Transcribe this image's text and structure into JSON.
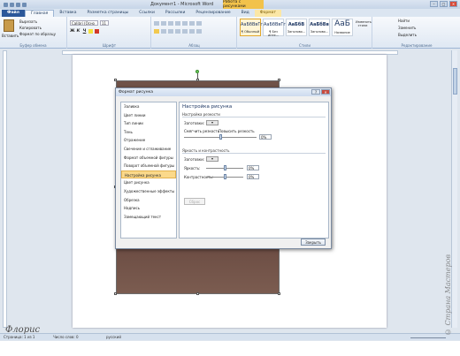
{
  "window": {
    "title": "Документ1 - Microsoft Word",
    "context_title": "Работа с рисунками"
  },
  "tabs": [
    "Файл",
    "Главная",
    "Вставка",
    "Разметка страницы",
    "Ссылки",
    "Рассылки",
    "Рецензирование",
    "Вид",
    "Формат"
  ],
  "ribbon": {
    "clipboard": {
      "paste": "Вставить",
      "cut": "Вырезать",
      "copy": "Копировать",
      "format_painter": "Формат по образцу",
      "label": "Буфер обмена"
    },
    "font": {
      "name": "Calibri (Осно",
      "size": "11",
      "label": "Шрифт",
      "bold": "Ж",
      "italic": "К",
      "underline": "Ч"
    },
    "paragraph": {
      "label": "Абзац"
    },
    "styles": {
      "label": "Стили",
      "items": [
        {
          "sample": "АаБбВвГг,",
          "name": "¶ Обычный"
        },
        {
          "sample": "АаБбВвГг,",
          "name": "¶ Без инте..."
        },
        {
          "sample": "АаБбВ",
          "name": "Заголово..."
        },
        {
          "sample": "АаБбВв",
          "name": "Заголово..."
        },
        {
          "sample": "АаБ",
          "name": "Название"
        }
      ],
      "change_styles": "Изменить стили"
    },
    "editing": {
      "find": "Найти",
      "replace": "Заменить",
      "select": "Выделить",
      "label": "Редактирование"
    }
  },
  "dialog": {
    "title": "Формат рисунка",
    "nav": [
      "Заливка",
      "Цвет линии",
      "Тип линии",
      "Тень",
      "Отражение",
      "Свечение и сглаживание",
      "Формат объемной фигуры",
      "Поворот объемной фигуры",
      "Настройка рисунка",
      "Цвет рисунка",
      "Художественные эффекты",
      "Обрезка",
      "Надпись",
      "Замещающий текст"
    ],
    "panel": {
      "heading": "Настройка рисунка",
      "sharpen_section": "Настройка резкости",
      "presets_label": "Заготовки:",
      "soften": "Смягчить резкость",
      "sharpen": "Повысить резкость",
      "sharpen_value": "0%",
      "sharpen_level": 0.5,
      "brightness_section": "Яркость и контрастность",
      "brightness_label": "Яркость:",
      "brightness_value": "0%",
      "brightness_level": 0.5,
      "contrast_label": "Контрастность:",
      "contrast_value": "0%",
      "contrast_level": 0.5,
      "reset": "Сброс"
    },
    "close": "Закрыть"
  },
  "status": {
    "page": "Страница: 1 из 1",
    "words": "Число слов: 0",
    "lang": "русский"
  },
  "watermark": {
    "left": "Флорис",
    "right": "© Страна Мастеров"
  }
}
